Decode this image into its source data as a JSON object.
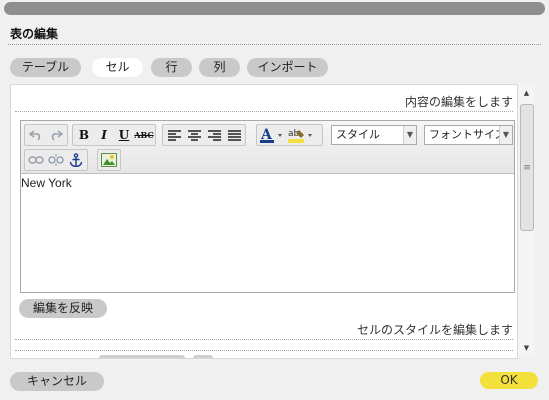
{
  "dialog": {
    "title": "表の編集"
  },
  "tabs": [
    {
      "label": "テーブル",
      "active": false
    },
    {
      "label": "セル",
      "active": true
    },
    {
      "label": "行",
      "active": false
    },
    {
      "label": "列",
      "active": false
    },
    {
      "label": "インポート",
      "active": false
    }
  ],
  "panel": {
    "content_hint": "内容の編集をします",
    "style_hint": "セルのスタイルを編集します",
    "apply_label": "編集を反映"
  },
  "toolbar": {
    "bold_label": "B",
    "italic_label": "I",
    "underline_label": "U",
    "strike_label": "ABC",
    "style_select_value": "スタイル",
    "fontsize_select_value": "フォントサイズ",
    "font_color_accent": "#1a3a8a",
    "highlight_accent": "#f0e040",
    "icons": [
      "undo-icon",
      "redo-icon",
      "bold-icon",
      "italic-icon",
      "underline-icon",
      "strikethrough-icon",
      "align-left-icon",
      "align-center-icon",
      "align-right-icon",
      "align-justify-icon",
      "font-color-icon",
      "highlight-color-icon",
      "link-icon",
      "unlink-icon",
      "anchor-icon",
      "image-icon"
    ]
  },
  "editor": {
    "content": "New York"
  },
  "footer": {
    "cancel_label": "キャンセル",
    "ok_label": "OK"
  },
  "colors": {
    "pill_bg": "#c9c9c9",
    "ok_bg": "#f3e03a",
    "topbar": "#8f8f8f"
  }
}
